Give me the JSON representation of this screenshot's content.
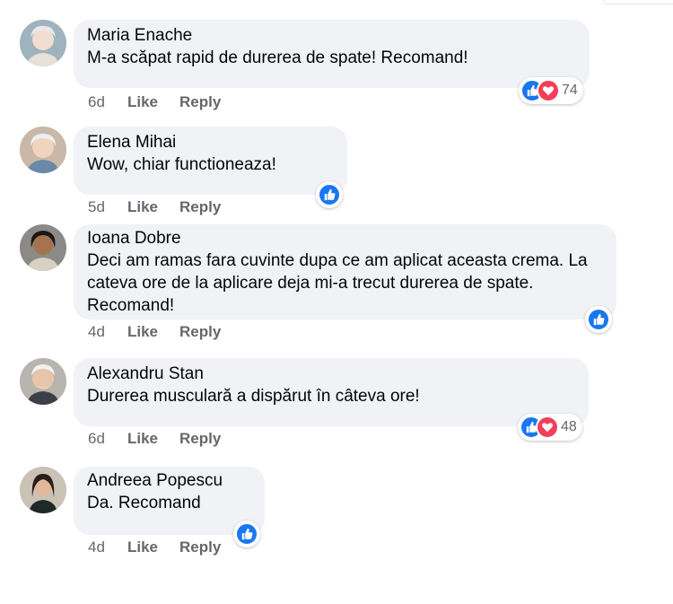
{
  "comments": [
    {
      "author": "Maria Enache",
      "text": "M-a scăpat rapid de durerea de spate! Recomand!",
      "time": "6d",
      "like": "Like",
      "reply": "Reply",
      "reaction_count": "74",
      "reactions": [
        "like-icon",
        "love-icon"
      ]
    },
    {
      "author": "Elena Mihai",
      "text": "Wow, chiar functioneaza!",
      "time": "5d",
      "like": "Like",
      "reply": "Reply",
      "reactions": [
        "like-icon"
      ]
    },
    {
      "author": "Ioana Dobre",
      "text": "Deci am ramas fara cuvinte dupa ce am aplicat aceasta crema. La cateva ore de la aplicare deja mi-a trecut durerea de spate. Recomand!",
      "time": "4d",
      "like": "Like",
      "reply": "Reply",
      "reactions": [
        "like-icon"
      ]
    },
    {
      "author": "Alexandru Stan",
      "text": "Durerea musculară a dispărut în câteva ore!",
      "time": "6d",
      "like": "Like",
      "reply": "Reply",
      "reaction_count": "48",
      "reactions": [
        "like-icon",
        "love-icon"
      ]
    },
    {
      "author": "Andreea Popescu",
      "text": "Da. Recomand",
      "time": "4d",
      "like": "Like",
      "reply": "Reply",
      "reactions": [
        "like-icon"
      ]
    }
  ],
  "colors": {
    "like": "#1877f2",
    "love": "#f33e58",
    "bubble": "#f0f2f5",
    "meta": "#65676b"
  }
}
